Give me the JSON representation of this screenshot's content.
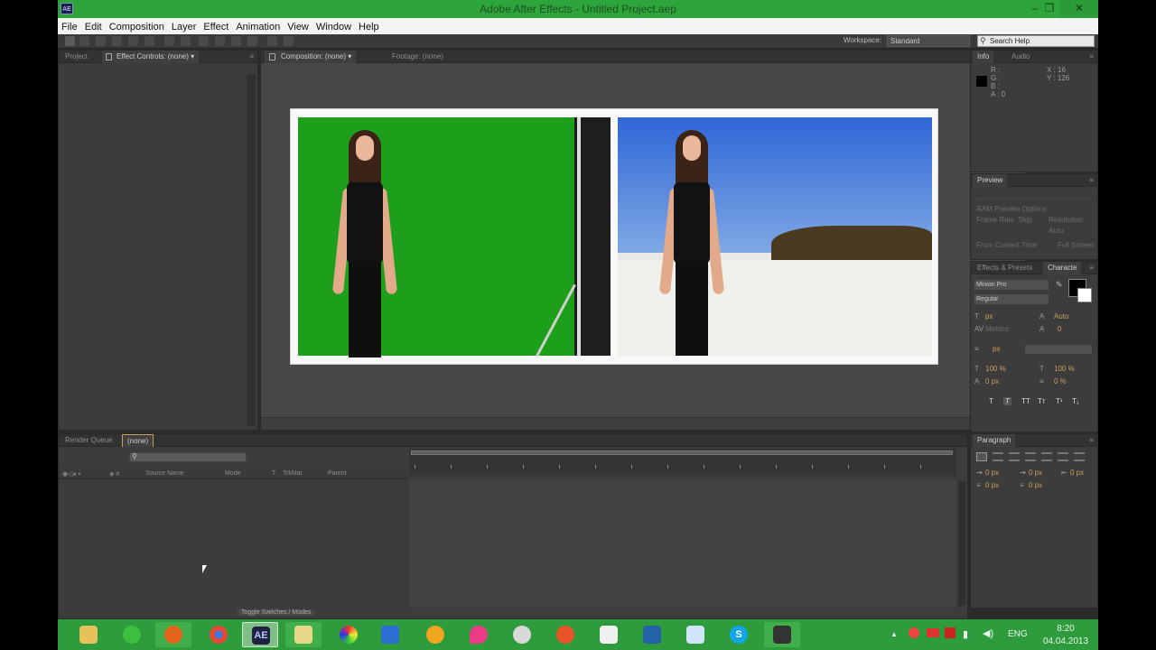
{
  "window": {
    "app_badge": "AE",
    "title": "Adobe After Effects - Untitled Project.aep",
    "minimize": "–",
    "restore": "❐",
    "close": "✕"
  },
  "menu": [
    "File",
    "Edit",
    "Composition",
    "Layer",
    "Effect",
    "Animation",
    "View",
    "Window",
    "Help"
  ],
  "toolbar": {
    "workspace_label": "Workspace:",
    "workspace_value": "Standard",
    "search_placeholder": "Search Help"
  },
  "left_panel": {
    "tab_project": "Project",
    "tab_effect_controls": "Effect Controls: (none)"
  },
  "comp_panel": {
    "tab_composition": "Composition: (none)",
    "tab_footage": "Footage: (none)"
  },
  "info_panel": {
    "tab_info": "Info",
    "tab_audio": "Audio",
    "r": "R :",
    "g": "G :",
    "b": "B :",
    "a": "A : 0",
    "x": "X : 16",
    "y": "Y : 126"
  },
  "preview_panel": {
    "tab_preview": "Preview",
    "ram_preview": "RAM Preview Options",
    "frame_rate": "Frame Rate",
    "skip": "Skip",
    "resolution": "Resolution",
    "auto": "Auto",
    "from_current": "From Current Time",
    "full_screen": "Full Screen"
  },
  "char_panel": {
    "tab_effects": "Effects & Presets",
    "tab_character": "Characte",
    "font": "Minion Pro",
    "style": "Regular",
    "size": "px",
    "leading": "Auto",
    "kerning": "Metrics",
    "tracking": "0",
    "stroke": "px",
    "vscale": "100 %",
    "hscale": "100 %",
    "baseline": "0 px",
    "tsume": "0 %",
    "format_buttons": [
      "T",
      "T",
      "TT",
      "Tт",
      "T¹",
      "T₁"
    ]
  },
  "paragraph_panel": {
    "tab": "Paragraph",
    "indent_left": "0 px",
    "indent_first": "0 px",
    "indent_right": "0 px",
    "space_before": "0 px",
    "space_after": "0 px"
  },
  "timeline": {
    "tab_render": "Render Queue",
    "tab_comp": "(none)",
    "columns": [
      "Source Name",
      "Mode",
      "T",
      "TrkMat",
      "Parent"
    ],
    "toggle": "Toggle Switches / Modes"
  },
  "taskbar": {
    "lang": "ENG",
    "time": "8:20",
    "date": "04.04.2013",
    "apps": [
      "file-explorer-icon",
      "clover-icon",
      "firefox-icon",
      "chrome-icon",
      "after-effects-icon",
      "notes-icon",
      "colorful-app-icon",
      "office-icon",
      "sling-icon",
      "pink-drop-icon",
      "game-icon",
      "orange-app-icon",
      "mail-icon",
      "book-icon",
      "paper-icon",
      "skype-icon",
      "film-icon"
    ],
    "ae_label": "AE",
    "skype_label": "S"
  }
}
